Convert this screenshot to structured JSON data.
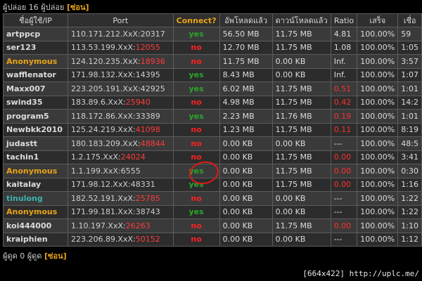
{
  "seeders_header": {
    "text": "ผู้ปล่อย 16 ผู้ปล่อย",
    "toggle": "[ซ่อน]"
  },
  "leechers_header": {
    "text": "ผู้ดูด 0 ผู้ดูด",
    "toggle": "[ซ่อน]"
  },
  "columns": [
    "ชื่อผู้ใช้/IP",
    "Port",
    "Connect?",
    "อัพโหลดแล้ว",
    "ดาวน์โหลดแล้ว",
    "Ratio",
    "เสร็จ",
    "เชื่อ"
  ],
  "rows": [
    {
      "user": "artppcp",
      "ip": "110.171.212.XxX",
      "port": "20317",
      "connect": "yes",
      "up": "56.50 MB",
      "down": "11.75 MB",
      "ratio": "4.81",
      "done": "100.00%",
      "time": "59"
    },
    {
      "user": "ser123",
      "ip": "113.53.199.XxX",
      "port": "12055",
      "connect": "no",
      "up": "12.70 MB",
      "down": "11.75 MB",
      "ratio": "1.08",
      "done": "100.00%",
      "time": "1:05"
    },
    {
      "user": "Anonymous",
      "ip": "124.120.235.XxX",
      "port": "18936",
      "connect": "no",
      "up": "11.75 MB",
      "down": "0.00 KB",
      "ratio": "Inf.",
      "done": "100.00%",
      "time": "3:57"
    },
    {
      "user": "wafflenator",
      "ip": "171.98.132.XxX",
      "port": "14395",
      "connect": "yes",
      "up": "8.43 MB",
      "down": "0.00 KB",
      "ratio": "Inf.",
      "done": "100.00%",
      "time": "1:07"
    },
    {
      "user": "Maxx007",
      "ip": "223.205.191.XxX",
      "port": "42925",
      "connect": "yes",
      "up": "6.02 MB",
      "down": "11.75 MB",
      "ratio": "0.51",
      "done": "100.00%",
      "time": "1:01"
    },
    {
      "user": "swind35",
      "ip": "183.89.6.XxX",
      "port": "25940",
      "connect": "no",
      "up": "4.98 MB",
      "down": "11.75 MB",
      "ratio": "0.42",
      "done": "100.00%",
      "time": "14:2"
    },
    {
      "user": "program5",
      "ip": "118.172.86.XxX",
      "port": "33389",
      "connect": "yes",
      "up": "2.23 MB",
      "down": "11.76 MB",
      "ratio": "0.19",
      "done": "100.00%",
      "time": "1:01"
    },
    {
      "user": "Newbkk2010",
      "ip": "125.24.219.XxX",
      "port": "41098",
      "connect": "no",
      "up": "1.23 MB",
      "down": "11.75 MB",
      "ratio": "0.11",
      "done": "100.00%",
      "time": "8:19"
    },
    {
      "user": "judastt",
      "ip": "180.183.209.XxX",
      "port": "48844",
      "connect": "no",
      "up": "0.00 KB",
      "down": "0.00 KB",
      "ratio": "---",
      "done": "100.00%",
      "time": "48:5"
    },
    {
      "user": "tachin1",
      "ip": "1.2.175.XxX",
      "port": "24024",
      "connect": "no",
      "up": "0.00 KB",
      "down": "11.75 MB",
      "ratio": "0.00",
      "done": "100.00%",
      "time": "3:41"
    },
    {
      "user": "Anonymous",
      "ip": "1.1.199.XxX",
      "port": "6555",
      "connect": "yes",
      "up": "0.00 KB",
      "down": "11.75 MB",
      "ratio": "0.00",
      "done": "100.00%",
      "time": "0:30"
    },
    {
      "user": "kaitalay",
      "ip": "171.98.12.XxX",
      "port": "48331",
      "connect": "yes",
      "up": "0.00 KB",
      "down": "11.75 MB",
      "ratio": "0.00",
      "done": "100.00%",
      "time": "1:16"
    },
    {
      "user": "tinulong",
      "ip": "182.52.191.XxX",
      "port": "25785",
      "connect": "no",
      "up": "0.00 KB",
      "down": "0.00 KB",
      "ratio": "---",
      "done": "100.00%",
      "time": "1:22"
    },
    {
      "user": "Anonymous",
      "ip": "171.99.181.XxX",
      "port": "38743",
      "connect": "yes",
      "up": "0.00 KB",
      "down": "0.00 KB",
      "ratio": "---",
      "done": "100.00%",
      "time": "1:22"
    },
    {
      "user": "koi444000",
      "ip": "1.10.197.XxX",
      "port": "26263",
      "connect": "no",
      "up": "0.00 KB",
      "down": "11.75 MB",
      "ratio": "0.00",
      "done": "100.00%",
      "time": "1:10"
    },
    {
      "user": "kraiphien",
      "ip": "223.206.89.XxX",
      "port": "50152",
      "connect": "no",
      "up": "0.00 KB",
      "down": "0.00 KB",
      "ratio": "---",
      "done": "100.00%",
      "time": "1:12"
    }
  ],
  "credit": "[664x422] http://uplc.me/"
}
